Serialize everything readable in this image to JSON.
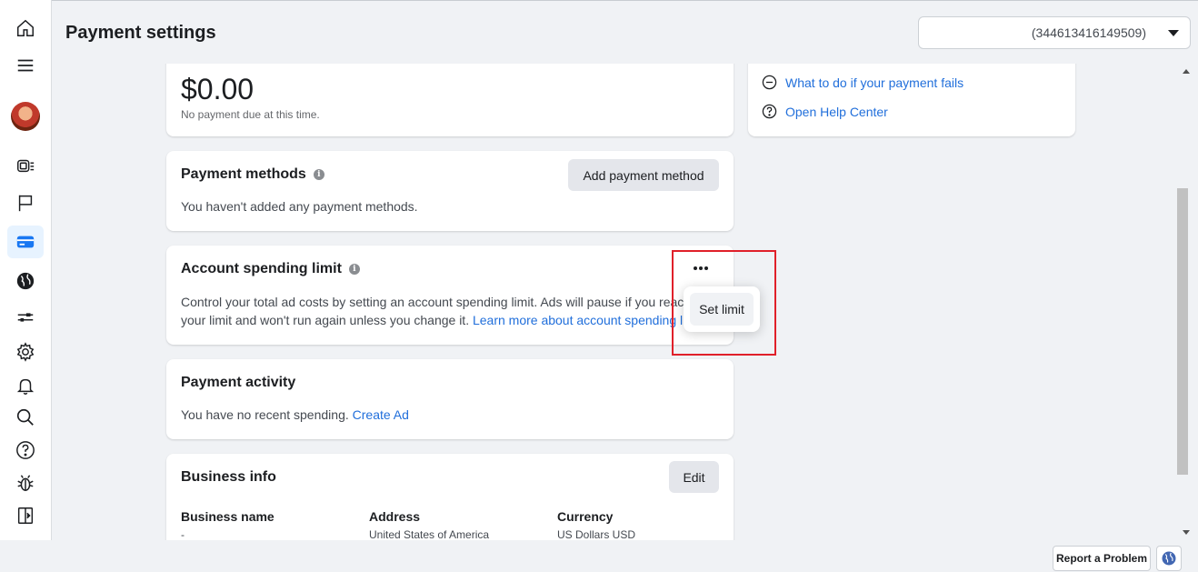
{
  "header": {
    "title": "Payment settings",
    "account_id": "(344613416149509)"
  },
  "rail": {
    "items": [
      "home-icon",
      "menu-icon",
      "avatar",
      "ads-manager-icon",
      "flag-icon",
      "billing-icon",
      "globe-icon",
      "sliders-icon",
      "gear-icon",
      "bell-icon",
      "search-icon",
      "help-icon",
      "bug-icon",
      "sidebar-toggle-icon"
    ],
    "active": "billing-icon",
    "accent": "#1877f2"
  },
  "balance": {
    "amount": "$0.00",
    "subtext": "No payment due at this time."
  },
  "help": {
    "links": [
      "What to do if your payment fails",
      "Open Help Center"
    ]
  },
  "payment_methods": {
    "title": "Payment methods",
    "button": "Add payment method",
    "empty_text": "You haven't added any payment methods."
  },
  "spending_limit": {
    "title": "Account spending limit",
    "text_line1": "Control your total ad costs by setting an account spending limit. Ads will pause if you reac",
    "text_line2": "your limit and won't run again unless you change it.",
    "learn_more": "Learn more about account spending li",
    "menu_item": "Set limit"
  },
  "payment_activity": {
    "title": "Payment activity",
    "text": "You have no recent spending.",
    "link": "Create Ad"
  },
  "business_info": {
    "title": "Business info",
    "edit_button": "Edit",
    "columns": [
      {
        "header": "Business name",
        "value": "-"
      },
      {
        "header": "Address",
        "value": "United States of America"
      },
      {
        "header": "Currency",
        "value": "US Dollars USD"
      }
    ]
  },
  "footer": {
    "report_button": "Report a Problem"
  },
  "colors": {
    "link": "#216fdb",
    "highlight_box": "#e0202a"
  }
}
